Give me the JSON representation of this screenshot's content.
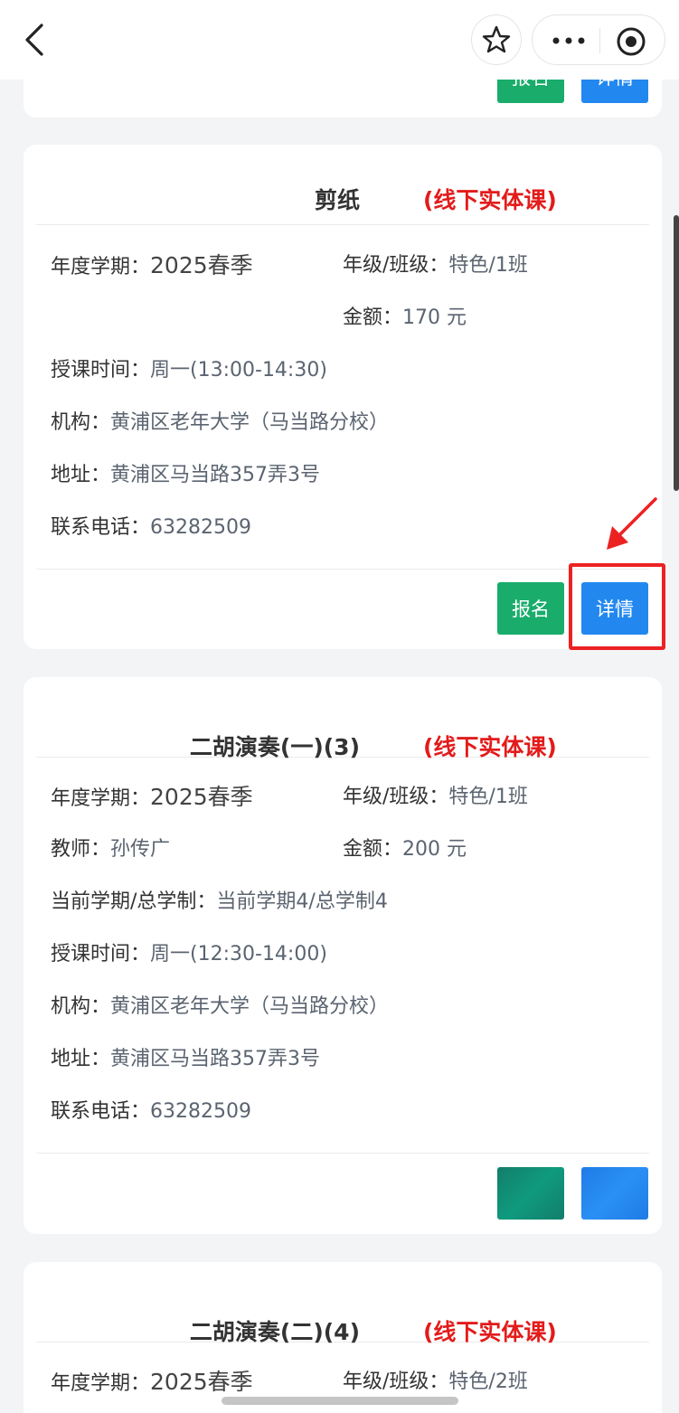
{
  "header": {
    "back_icon": "back-arrow-icon",
    "star_icon": "star-icon",
    "more_icon": "more-dots-icon",
    "target_icon": "target-icon"
  },
  "labels": {
    "term": "年度学期：",
    "grade": "年级/班级：",
    "teacher": "教师：",
    "fee": "金额：",
    "period": "当前学期/总学制：",
    "time": "授课时间：",
    "org": "机构：",
    "address": "地址：",
    "phone": "联系电话："
  },
  "buttons": {
    "enroll": "报名",
    "detail": "详情"
  },
  "top_card": {
    "enroll_label": "报名",
    "detail_label": "详情"
  },
  "courses": [
    {
      "name": "剪纸",
      "type": "(线下实体课)",
      "term": "2025春季",
      "grade": "特色/1班",
      "fee": "170 元",
      "time": "周一(13:00-14:30)",
      "org": "黄浦区老年大学（马当路分校）",
      "address": "黄浦区马当路357弄3号",
      "phone": "63282509"
    },
    {
      "name": "二胡演奏(一)(3)",
      "type": "(线下实体课)",
      "term": "2025春季",
      "grade": "特色/1班",
      "teacher": "孙传广",
      "fee": "200 元",
      "period": "当前学期4/总学制4",
      "time": "周一(12:30-14:00)",
      "org": "黄浦区老年大学（马当路分校）",
      "address": "黄浦区马当路357弄3号",
      "phone": "63282509"
    },
    {
      "name": "二胡演奏(二)(4)",
      "type": "(线下实体课)",
      "term": "2025春季",
      "grade": "特色/2班"
    }
  ],
  "colors": {
    "enroll_green": "#1aac6b",
    "detail_blue": "#2288f0",
    "course_type_red": "#e31b1b",
    "highlight_red": "#ec2222"
  }
}
